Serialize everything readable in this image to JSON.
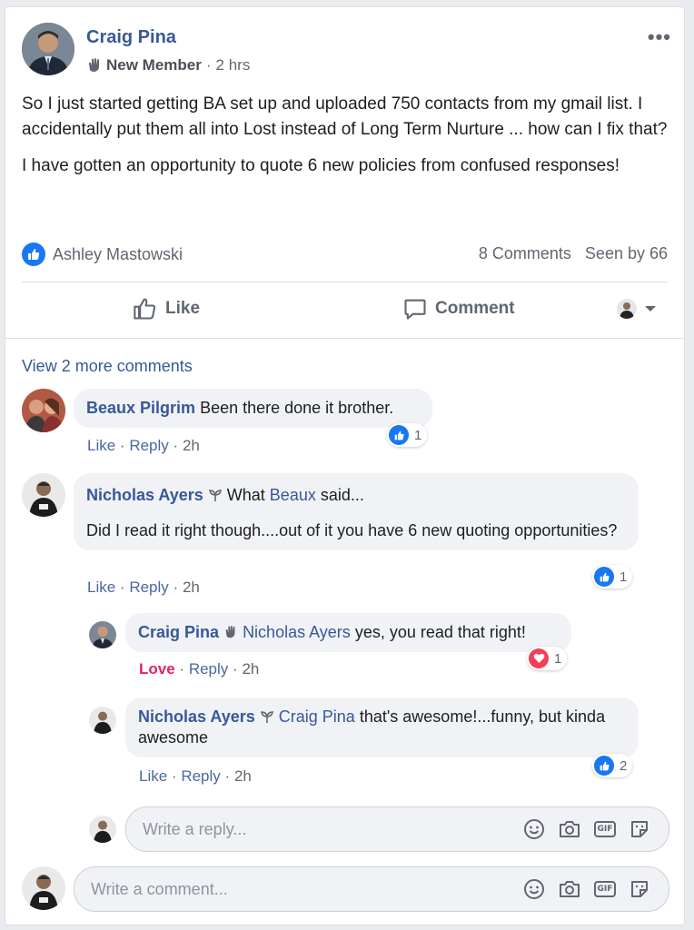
{
  "post": {
    "author": "Craig Pina",
    "badge": "New Member",
    "separator": "·",
    "time": "2 hrs",
    "more": "•••",
    "paragraphs": [
      "So I just started getting BA set up and uploaded 750 contacts from my gmail list. I accidentally put them all into Lost instead of Long Term Nurture ... how can I fix that?",
      "I have gotten an opportunity to quote 6 new policies from confused responses!"
    ],
    "reactor": "Ashley Mastowski",
    "comments_count": "8 Comments",
    "seen_by": "Seen by 66"
  },
  "actions": {
    "like": "Like",
    "comment": "Comment"
  },
  "view_more": "View 2 more comments",
  "comments": [
    {
      "author": "Beaux Pilgrim",
      "text": "Been there done it brother.",
      "like": "Like",
      "reply": "Reply",
      "time": "2h",
      "reaction_count": "1"
    },
    {
      "author": "Nicholas Ayers",
      "mention": "Beaux",
      "text_before": "What",
      "text_after": "said...",
      "text2": "Did I read it right though....out of it you have 6 new quoting opportunities?",
      "like": "Like",
      "reply": "Reply",
      "time": "2h",
      "reaction_count": "1"
    }
  ],
  "replies": [
    {
      "author": "Craig Pina",
      "mention": "Nicholas Ayers",
      "text": "yes, you read that right!",
      "like": "Love",
      "reply": "Reply",
      "time": "2h",
      "reaction_count": "1"
    },
    {
      "author": "Nicholas Ayers",
      "mention": "Craig Pina",
      "text": "that's awesome!...funny, but kinda awesome",
      "like": "Like",
      "reply": "Reply",
      "time": "2h",
      "reaction_count": "2"
    }
  ],
  "reply_input": {
    "placeholder": "Write a reply..."
  },
  "comment_input": {
    "placeholder": "Write a comment..."
  },
  "colors": {
    "link": "#385898",
    "like_blue": "#1877f2",
    "love_red": "#e0245e"
  }
}
